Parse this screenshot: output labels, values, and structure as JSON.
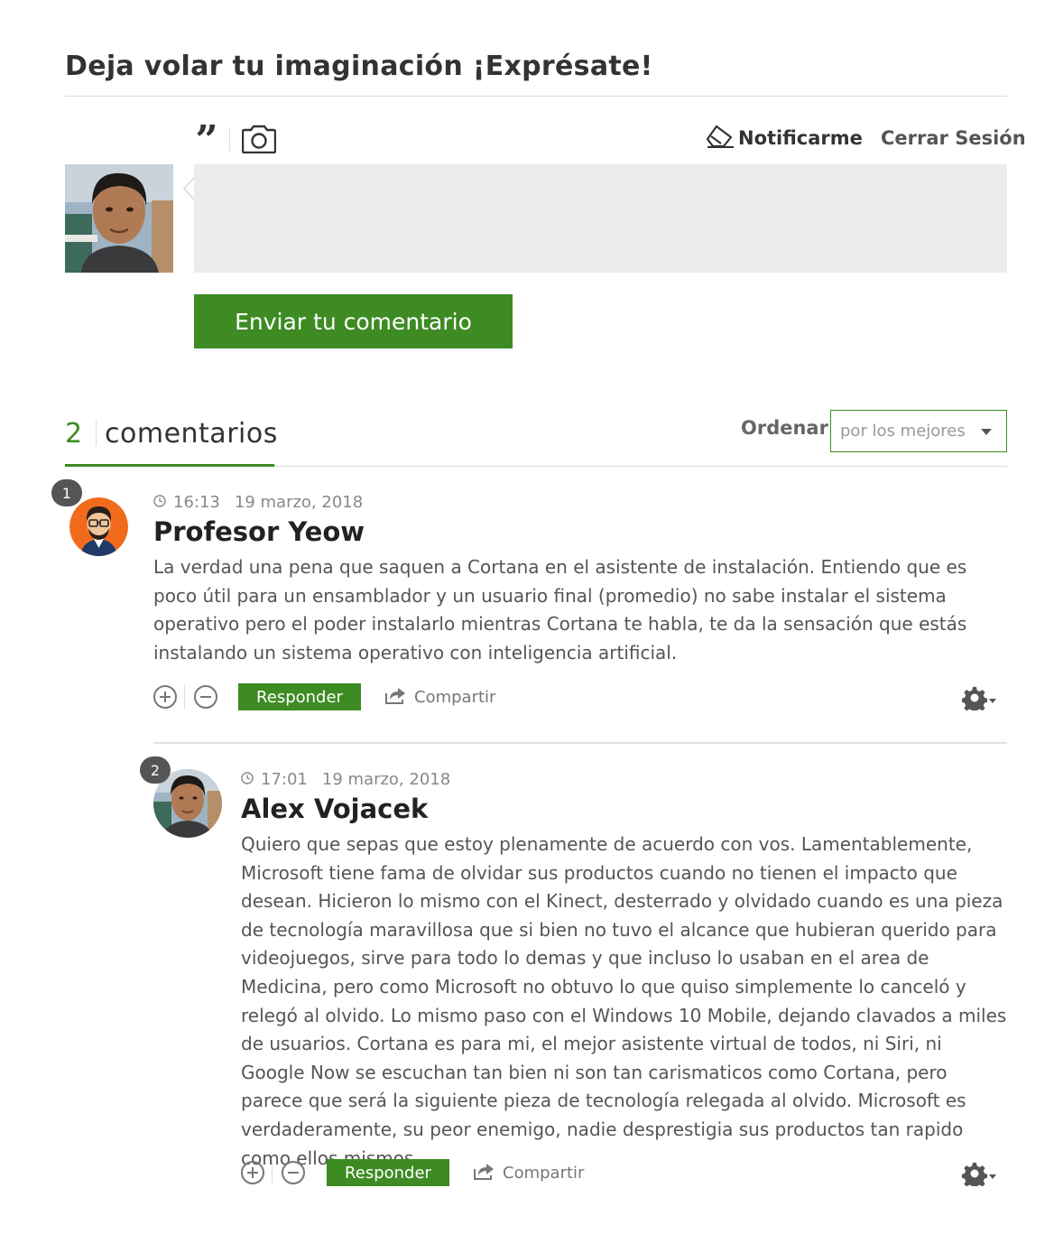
{
  "form": {
    "title": "Deja volar tu imaginación ¡Exprésate!",
    "quote_glyph": "”",
    "notify_label": "Notificarme",
    "logout_label": "Cerrar Sesión",
    "comment_value": "",
    "send_label": "Enviar tu comentario"
  },
  "comments_header": {
    "count": "2",
    "label": "comentarios",
    "sort_label": "Ordenar:",
    "sort_value": "por los mejores"
  },
  "comments": [
    {
      "number": "1",
      "time": "16:13",
      "date": "19 marzo, 2018",
      "author": "Profesor Yeow",
      "text": "La verdad una pena que saquen a Cortana en el asistente de instalación. Entiendo que es poco útil para un ensamblador y un usuario final (promedio) no sabe instalar el sistema operativo pero el poder instalarlo mientras Cortana te habla, te da la sensación que estás instalando un sistema operativo con inteligencia artificial.",
      "reply_label": "Responder",
      "share_label": "Compartir"
    },
    {
      "number": "2",
      "time": "17:01",
      "date": "19 marzo, 2018",
      "author": "Alex Vojacek",
      "text": "Quiero que sepas que estoy plenamente de acuerdo con vos. Lamentablemente, Microsoft tiene fama de olvidar sus productos cuando no tienen el impacto que desean. Hicieron lo mismo con el Kinect, desterrado y olvidado cuando es una pieza de tecnología maravillosa que si bien no tuvo el alcance que hubieran querido para videojuegos, sirve para todo lo demas y que incluso lo usaban en el area de Medicina, pero como Microsoft no obtuvo lo que quiso simplemente lo canceló y relegó al olvido. Lo mismo paso con el Windows 10 Mobile, dejando clavados a miles de usuarios. Cortana es para mi, el mejor asistente virtual de todos, ni Siri, ni Google Now se escuchan tan bien ni son tan carismaticos como Cortana, pero parece que será la siguiente pieza de tecnología relegada al olvido. Microsoft es verdaderamente, su peor enemigo, nadie desprestigia sus productos tan rapido como ellos mismos.",
      "reply_label": "Responder",
      "share_label": "Compartir"
    }
  ],
  "colors": {
    "accent": "#3d8b22",
    "badge": "#555555",
    "comment_box": "#ececec"
  },
  "icons": [
    "quote-icon",
    "camera-icon",
    "eraser-icon",
    "clock-icon",
    "upvote-icon",
    "downvote-icon",
    "share-icon",
    "gear-icon"
  ]
}
